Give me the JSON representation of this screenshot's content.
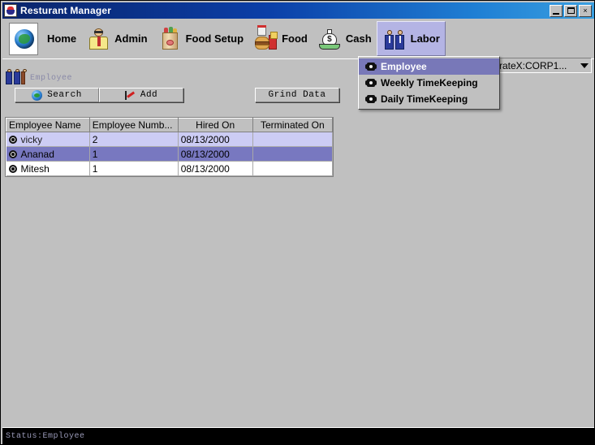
{
  "window": {
    "title": "Resturant Manager",
    "icon": "chef-cup-icon",
    "controls": {
      "minimize": "minimize-button",
      "maximize": "maximize-button",
      "close_label": "×"
    }
  },
  "toolbar": {
    "items": [
      {
        "label": "Home",
        "icon": "globe-icon",
        "selected": false
      },
      {
        "label": "Admin",
        "icon": "person-icon",
        "selected": false
      },
      {
        "label": "Food Setup",
        "icon": "grocery-bag-icon",
        "selected": false
      },
      {
        "label": "Food",
        "icon": "burger-icon",
        "selected": false
      },
      {
        "label": "Cash",
        "icon": "money-bag-icon",
        "selected": false
      },
      {
        "label": "Labor",
        "icon": "two-people-icon",
        "selected": true
      }
    ]
  },
  "menu": {
    "items": [
      {
        "label": "Employee",
        "active": true
      },
      {
        "label": "Weekly TimeKeeping",
        "active": false
      },
      {
        "label": "Daily TimeKeeping",
        "active": false
      }
    ]
  },
  "combo": {
    "value": "rateX:CORP1...",
    "arrow_icon": "chevron-down-icon"
  },
  "breadcrumb": {
    "label": "Employee",
    "icon": "two-people-small-icon"
  },
  "actions": {
    "search_label": "Search",
    "add_label": "Add",
    "grind_label": "Grind Data"
  },
  "table": {
    "columns": [
      "Employee Name",
      "Employee Numb...",
      "Hired On",
      "Terminated On"
    ],
    "rows": [
      {
        "name": "vicky",
        "number": "2",
        "hired_on": "08/13/2000",
        "terminated_on": "",
        "state": "alt"
      },
      {
        "name": "Ananad",
        "number": "1",
        "hired_on": "08/13/2000",
        "terminated_on": "",
        "state": "selected"
      },
      {
        "name": "Mitesh",
        "number": "1",
        "hired_on": "08/13/2000",
        "terminated_on": "",
        "state": "plain"
      }
    ]
  },
  "statusbar": {
    "text": "Status:Employee"
  },
  "colors": {
    "titlebar_start": "#0a246a",
    "titlebar_end": "#3a9fe0",
    "face": "#c0c0c0",
    "selected_toolbar": "#b4b4e4",
    "menu_highlight": "#7878b8",
    "row_alt": "#ccccf4",
    "row_selected": "#7878c0",
    "link_text": "#2020d0",
    "status_text": "#9a9ab8"
  }
}
